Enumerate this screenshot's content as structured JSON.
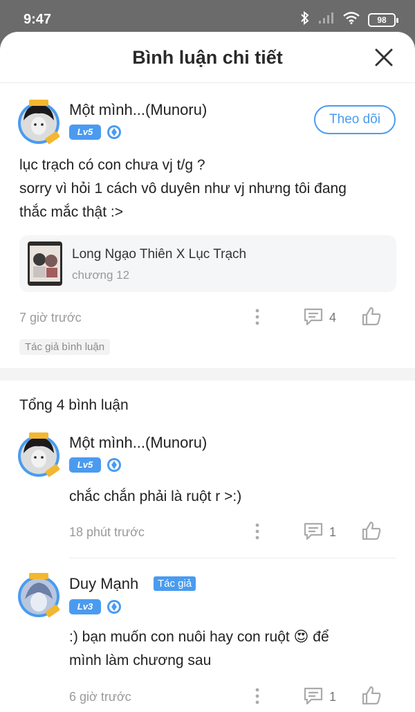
{
  "status": {
    "time": "9:47",
    "battery": "98"
  },
  "header": {
    "title": "Bình luận chi tiết"
  },
  "main_comment": {
    "username": "Một mình...(Munoru)",
    "level": "Lv5",
    "follow_label": "Theo dõi",
    "text_lines": [
      "lục trạch có con chưa vj t/g ?",
      "sorry vì hỏi 1 cách vô duyên như vj nhưng tôi đang",
      "thắc mắc thật :>"
    ],
    "ref": {
      "title": "Long Ngạo Thiên X Lục Trạch",
      "chapter": "chương 12"
    },
    "time": "7 giờ trước",
    "reply_count": "4",
    "author_chip": "Tác giả bình luận"
  },
  "total_label": "Tổng 4 bình luận",
  "replies": [
    {
      "username": "Một mình...(Munoru)",
      "level": "Lv5",
      "text_lines": [
        "chắc chắn phải là ruột r >:)"
      ],
      "time": "18 phút trước",
      "reply_count": "1"
    },
    {
      "username": "Duy Mạnh",
      "tag": "Tác giả",
      "level": "Lv3",
      "text_lines": [
        ":) bạn muốn con nuôi hay con ruột 😍 để",
        "mình làm chương sau"
      ],
      "time": "6 giờ trước",
      "reply_count": "1"
    }
  ],
  "colors": {
    "accent": "#4a9bf0",
    "status_bar": "#6b6b6b"
  },
  "icons": [
    "bluetooth-icon",
    "signal-icon",
    "wifi-icon",
    "battery-icon",
    "close-icon",
    "more-icon",
    "comment-icon",
    "like-icon",
    "gem-icon"
  ]
}
